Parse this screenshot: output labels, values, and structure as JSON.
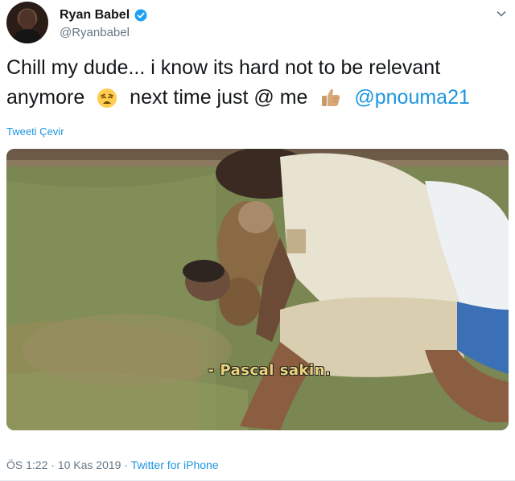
{
  "user": {
    "display_name": "Ryan Babel",
    "handle": "@Ryanbabel",
    "verified": true
  },
  "tweet": {
    "text_part1": "Chill my dude... i know its hard not to be relevant anymore",
    "emoji1": "weary-face",
    "text_part2": "next time just @ me",
    "emoji2": "thumbs-up-medium-skin",
    "mention": "@pnouma21"
  },
  "translate_label": "Tweeti Çevir",
  "media": {
    "subtitle": "- Pascal sakin."
  },
  "meta": {
    "time": "ÖS 1:22",
    "date": "10 Kas 2019",
    "separator": "·",
    "source": "Twitter for iPhone"
  },
  "colors": {
    "link": "#1b95e0",
    "text": "#14171a",
    "secondary": "#657786",
    "verified": "#1da1f2"
  }
}
